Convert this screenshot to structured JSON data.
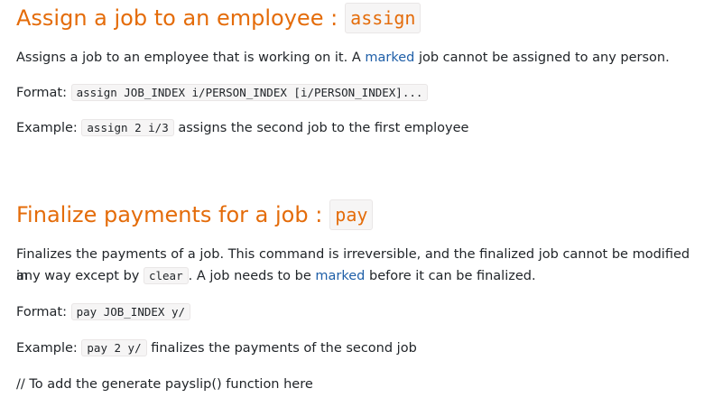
{
  "assign": {
    "heading": "Assign a job to an employee :",
    "command": "assign",
    "desc_before": "Assigns a job to an employee that is working on it. A",
    "desc_link": "marked",
    "desc_after": "job cannot be assigned to any person.",
    "format_label": "Format:",
    "format_code": "assign JOB_INDEX i/PERSON_INDEX [i/PERSON_INDEX]...",
    "example_label": "Example:",
    "example_code": "assign 2 i/3",
    "example_text": "assigns the second job to the first employee"
  },
  "pay": {
    "heading": "Finalize payments for a job :",
    "command": "pay",
    "desc_line1": "Finalizes the payments of a job. This command is irreversible, and the finalized job cannot be modified in",
    "desc_line2_before": "any way except by",
    "desc_line2_code": "clear",
    "desc_line2_mid": ". A job needs to be",
    "desc_link": "marked",
    "desc_line2_after": "before it can be finalized.",
    "format_label": "Format:",
    "format_code": "pay JOB_INDEX y/",
    "example_label": "Example:",
    "example_code": "pay 2 y/",
    "example_text": "finalizes the payments of the second job",
    "comment": "// To add the generate payslip() function here"
  }
}
